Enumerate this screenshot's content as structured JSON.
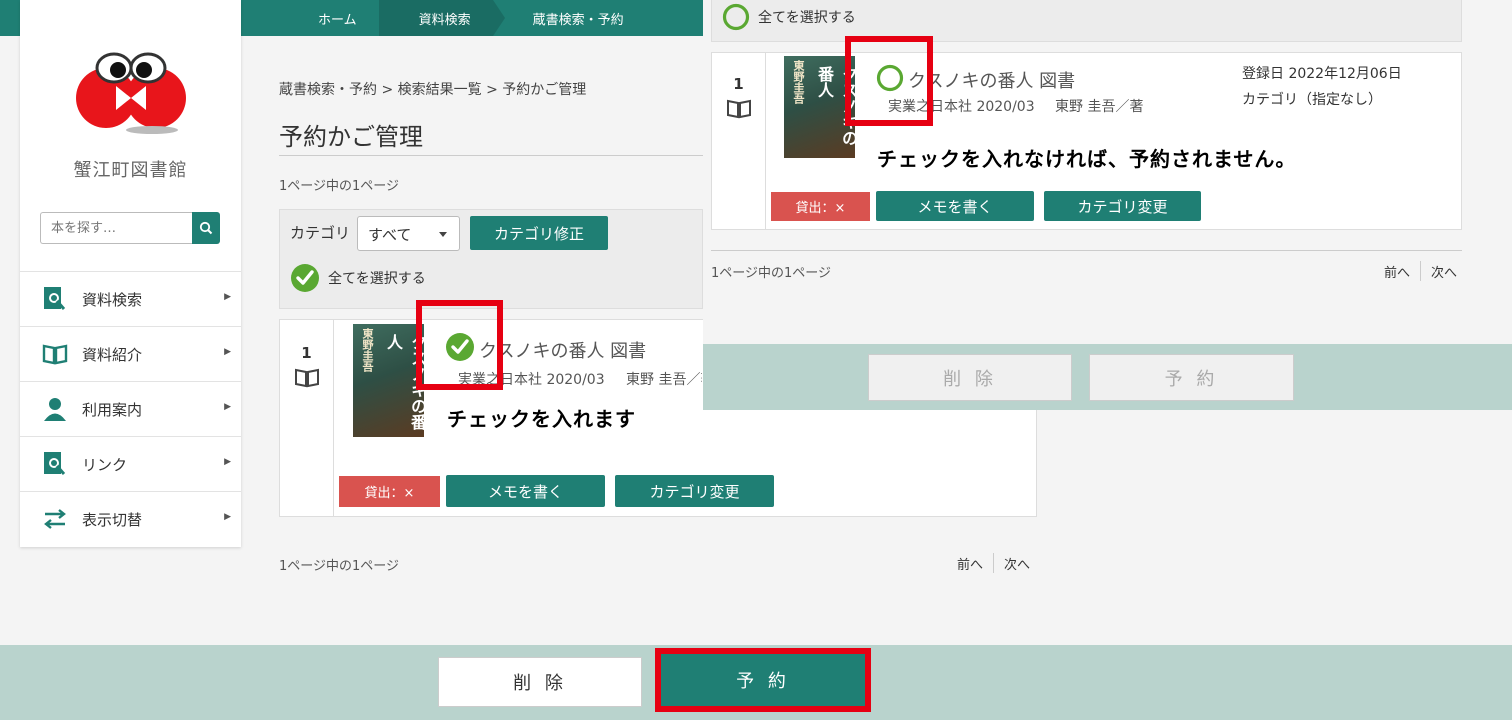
{
  "header": {
    "breadcrumbs": [
      "ホーム",
      "資料検索",
      "蔵書検索・予約"
    ]
  },
  "sidebar": {
    "library_name": "蟹江町図書館",
    "search_placeholder": "本を探す…",
    "items": [
      {
        "label": "資料検索"
      },
      {
        "label": "資料紹介"
      },
      {
        "label": "利用案内"
      },
      {
        "label": "リンク"
      },
      {
        "label": "表示切替"
      }
    ]
  },
  "main": {
    "breadcrumb": "蔵書検索・予約 > 検索結果一覧 > 予約かご管理",
    "title": "予約かご管理",
    "page_info": "1ページ中の1ページ",
    "category_label": "カテゴリ",
    "category_value": "すべて",
    "category_edit_button": "カテゴリ修正",
    "select_all": "全てを選択する",
    "item": {
      "number": "1",
      "title": "クスノキの番人 図書",
      "publisher_year": "実業之日本社 2020/03",
      "author": "東野 圭吾／著",
      "author_full": "東野 圭吾／著",
      "cover_author": "東野圭吾",
      "cover_title": "クスノキの番人",
      "loan_status": "貸出：×",
      "memo_button": "メモを書く",
      "category_change_button": "カテゴリ変更",
      "registered": "登録日 2022年12月06日",
      "category": "カテゴリ（指定なし）"
    },
    "pager": {
      "prev": "前へ",
      "next": "次へ"
    }
  },
  "bottom_bar": {
    "delete_button": "削 除",
    "reserve_button": "予 約"
  },
  "annotations": {
    "check_note": "チェックを入れます",
    "uncheck_note": "チェックを入れなければ、予約されません。"
  },
  "colors": {
    "brand_teal": "#1f7f74",
    "check_green": "#5aa832",
    "loan_red": "#d9534f",
    "highlight_red": "#e60012",
    "bottom_bar": "#b9d3cd"
  }
}
